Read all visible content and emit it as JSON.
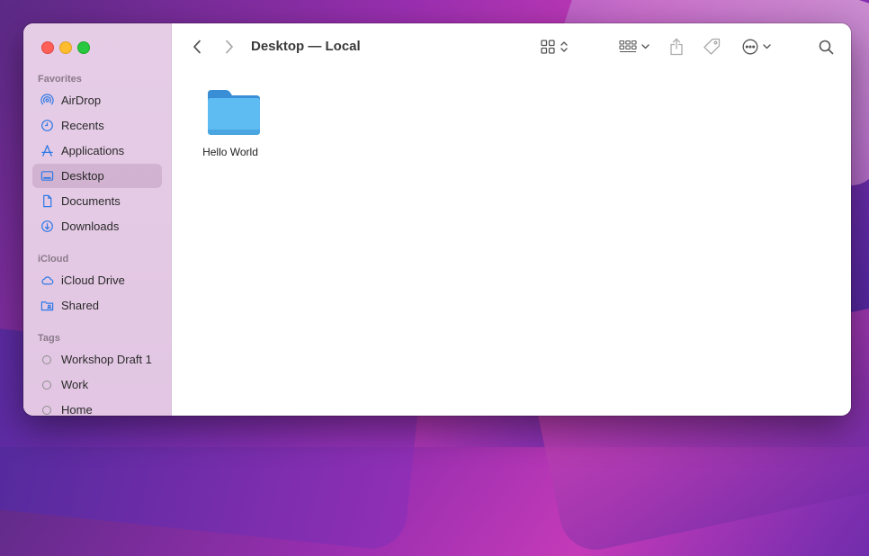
{
  "window": {
    "title": "Desktop — Local"
  },
  "sidebar": {
    "sections": [
      {
        "header": "Favorites",
        "items": [
          {
            "label": "AirDrop",
            "icon": "airdrop-icon"
          },
          {
            "label": "Recents",
            "icon": "clock-icon"
          },
          {
            "label": "Applications",
            "icon": "applications-icon"
          },
          {
            "label": "Desktop",
            "icon": "desktop-icon",
            "selected": true
          },
          {
            "label": "Documents",
            "icon": "document-icon"
          },
          {
            "label": "Downloads",
            "icon": "download-icon"
          }
        ]
      },
      {
        "header": "iCloud",
        "items": [
          {
            "label": "iCloud Drive",
            "icon": "cloud-icon"
          },
          {
            "label": "Shared",
            "icon": "shared-folder-icon"
          }
        ]
      },
      {
        "header": "Tags",
        "items": [
          {
            "label": "Workshop Draft 1",
            "icon": "tag-circle-icon"
          },
          {
            "label": "Work",
            "icon": "tag-circle-icon"
          },
          {
            "label": "Home",
            "icon": "tag-circle-icon"
          }
        ]
      }
    ]
  },
  "toolbar": {
    "icons": [
      "chevron-left-icon",
      "chevron-right-icon",
      "icon-view-grid-icon",
      "group-by-icon",
      "share-icon",
      "tag-icon",
      "more-actions-icon",
      "search-icon"
    ]
  },
  "content": {
    "items": [
      {
        "name": "Hello World",
        "type": "folder",
        "icon": "folder-icon"
      }
    ]
  },
  "colors": {
    "accent": "#2f7ae5",
    "folder": "#5ab8f0",
    "close": "#ff5f57",
    "minimize": "#febc2e",
    "zoom": "#28c840"
  }
}
